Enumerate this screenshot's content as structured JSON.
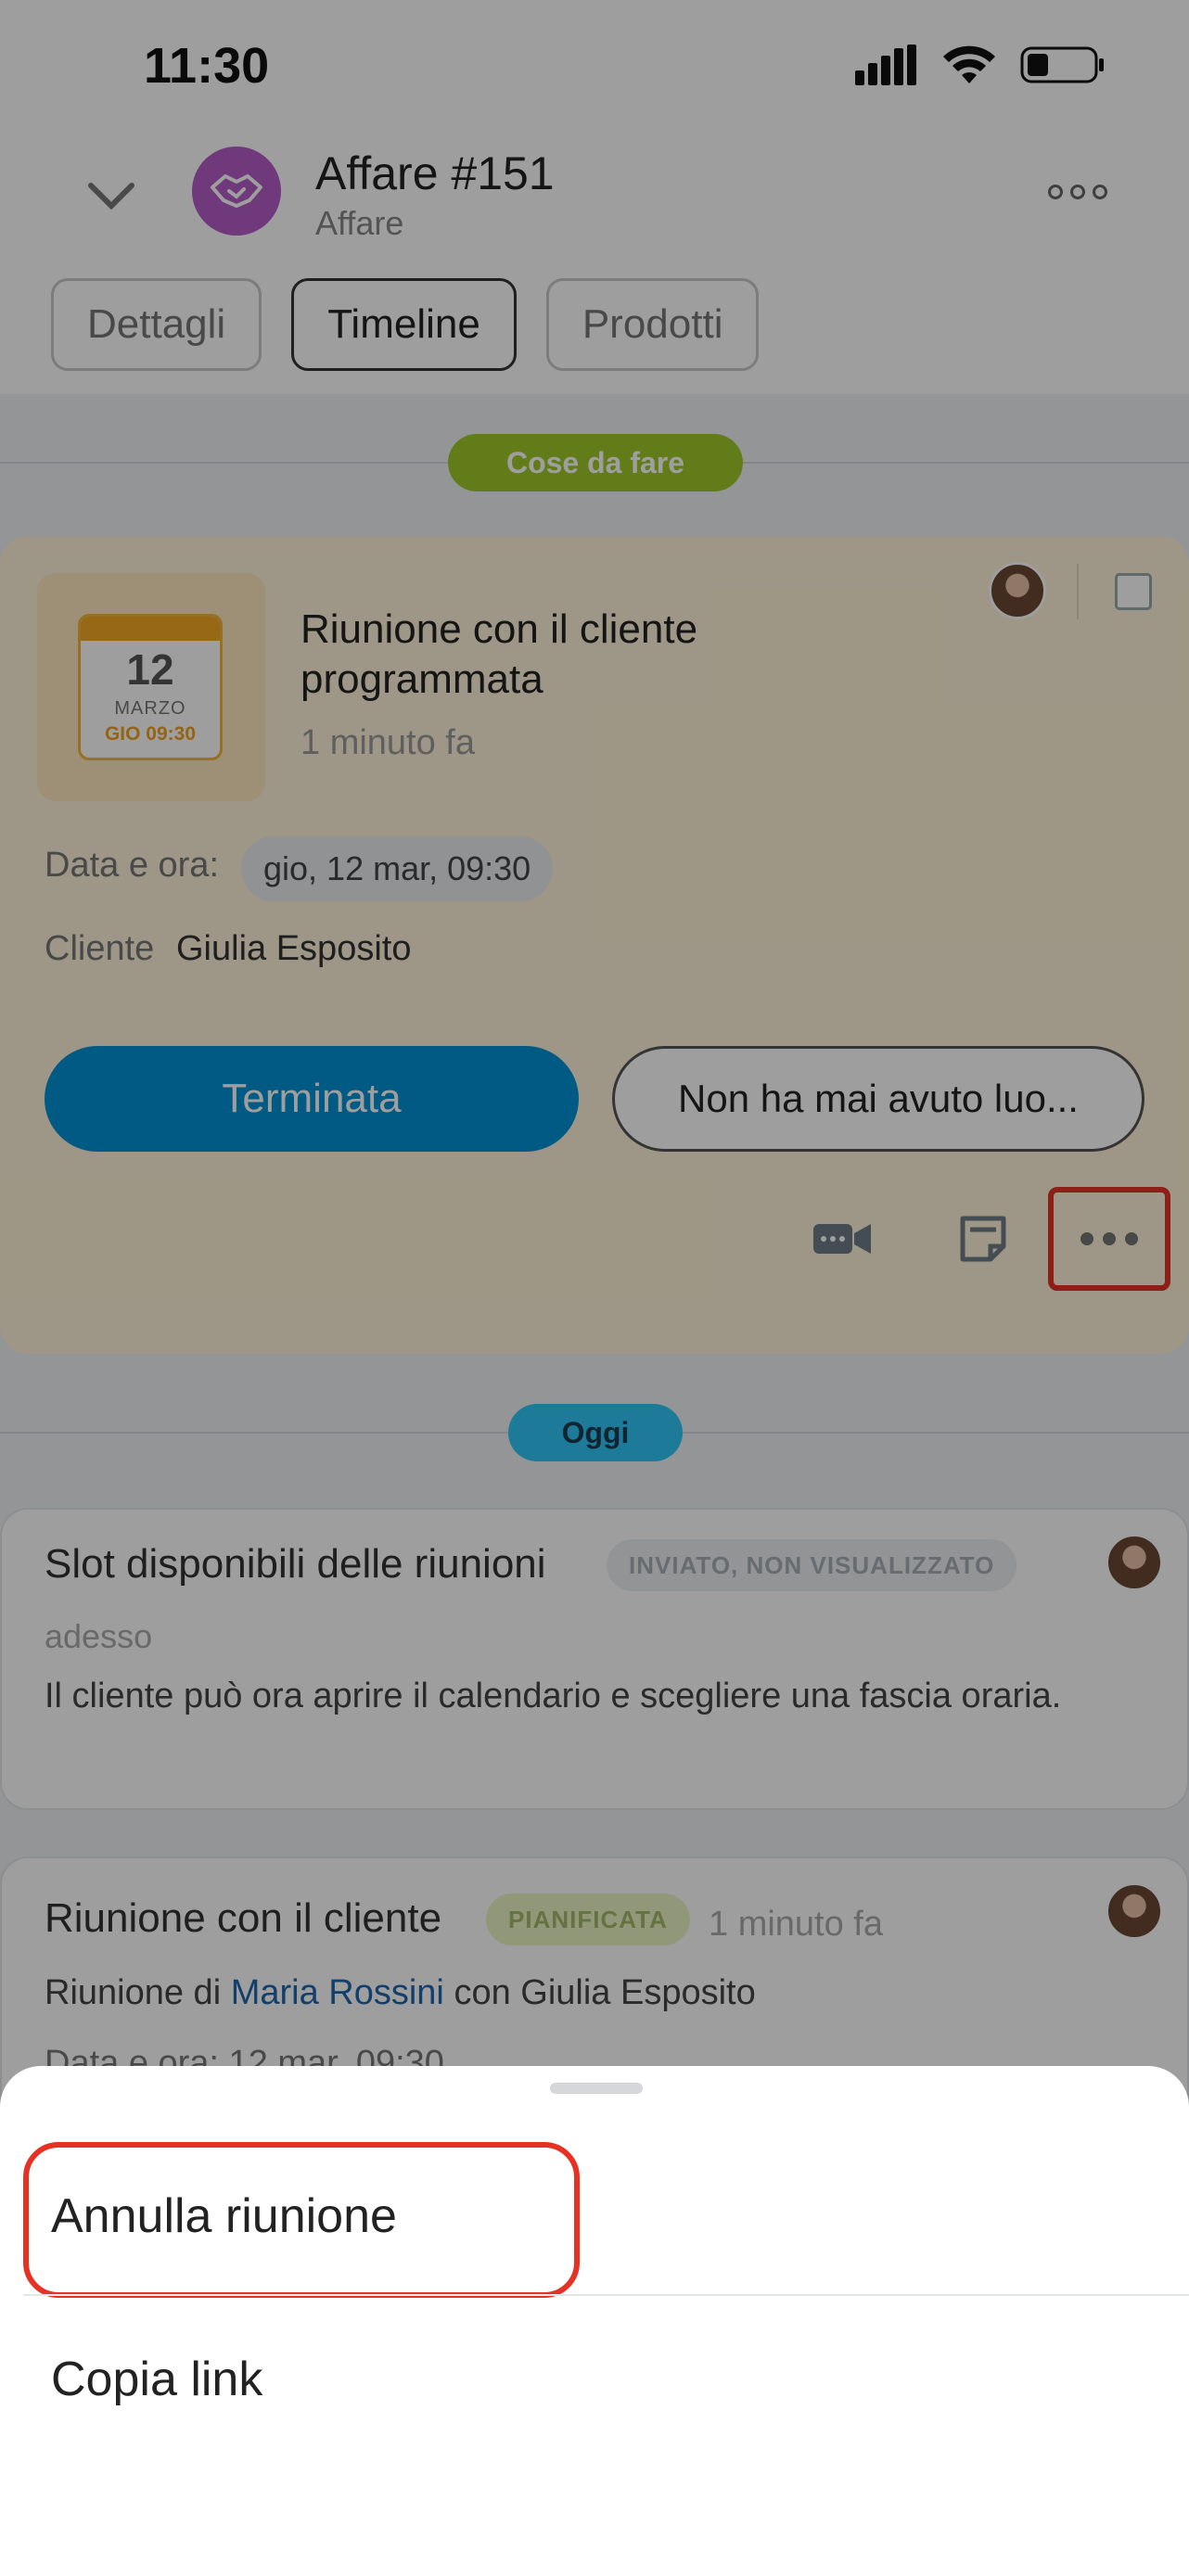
{
  "status_bar": {
    "time": "11:30"
  },
  "header": {
    "title": "Affare #151",
    "subtitle": "Affare"
  },
  "tabs": [
    {
      "label": "Dettagli",
      "active": false
    },
    {
      "label": "Timeline",
      "active": true
    },
    {
      "label": "Prodotti",
      "active": false
    }
  ],
  "sections": {
    "todo": "Cose da fare",
    "today": "Oggi"
  },
  "activity": {
    "calendar": {
      "day": "12",
      "month": "MARZO",
      "time": "GIO 09:30"
    },
    "title": "Riunione con il cliente programmata",
    "time_ago": "1 minuto fa",
    "date_label": "Data e ora:",
    "date_value": "gio, 12 mar, 09:30",
    "client_label": "Cliente",
    "client_value": "Giulia Esposito",
    "primary_button": "Terminata",
    "secondary_button": "Non ha mai avuto luo..."
  },
  "timeline_items": [
    {
      "title": "Slot disponibili delle riunioni",
      "badge": "INVIATO, NON VISUALIZZATO",
      "time": "adesso",
      "text": "Il cliente può ora aprire il calendario e scegliere una fascia oraria."
    },
    {
      "title": "Riunione con il cliente",
      "badge": "PIANIFICATA",
      "time": "1 minuto fa",
      "text_prefix": "Riunione di",
      "text_link": "Maria Rossini",
      "text_suffix": "con Giulia Esposito",
      "date_partial": "Data e ora:  12 mar, 09:30"
    }
  ],
  "sheet": {
    "items": [
      {
        "label": "Annulla riunione"
      },
      {
        "label": "Copia link"
      }
    ]
  },
  "colors": {
    "accent_blue": "#0091d4",
    "todo_green": "#9fc92b",
    "today_blue": "#2fc6f6",
    "highlight_red": "#e53224",
    "activity_bg": "#fff3d8"
  }
}
